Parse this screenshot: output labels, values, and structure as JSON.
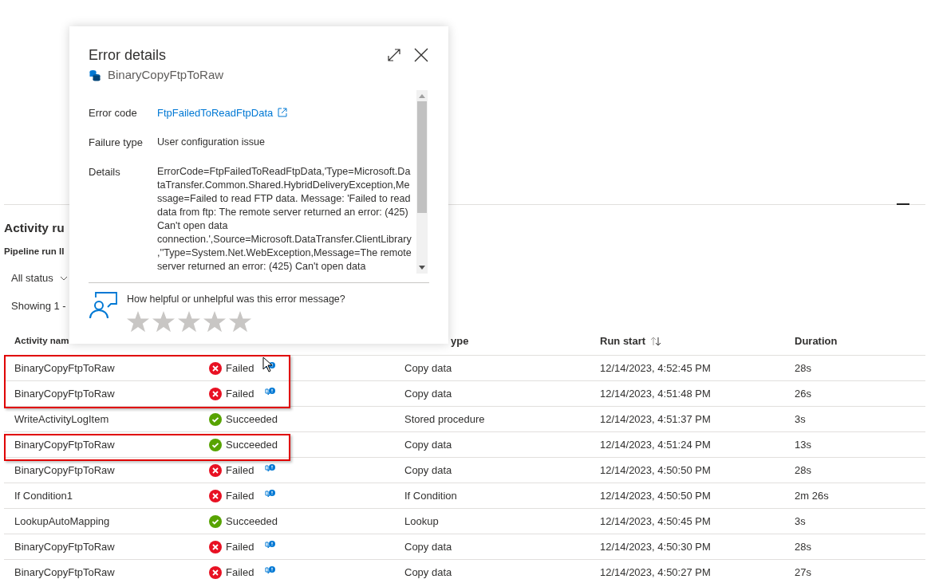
{
  "page": {
    "title": "Activity ru",
    "pipeline_run": "Pipeline run II",
    "status_filter": "All status",
    "showing": "Showing 1 -"
  },
  "table": {
    "columns": [
      {
        "label": "Activity nam"
      },
      {
        "label": "ype"
      },
      {
        "label": "Run start",
        "sortable": true
      },
      {
        "label": "Duration"
      }
    ],
    "rows": [
      {
        "name": "BinaryCopyFtpToRaw",
        "kind": "failed",
        "status_text": "Failed",
        "feedback": true,
        "type": "Copy data",
        "run_start": "12/14/2023, 4:52:45 PM",
        "duration": "28s",
        "highlighted": true
      },
      {
        "name": "BinaryCopyFtpToRaw",
        "kind": "failed",
        "status_text": "Failed",
        "feedback": true,
        "type": "Copy data",
        "run_start": "12/14/2023, 4:51:48 PM",
        "duration": "26s",
        "highlighted": true
      },
      {
        "name": "WriteActivityLogItem",
        "kind": "succeeded",
        "status_text": "Succeeded",
        "feedback": false,
        "type": "Stored procedure",
        "run_start": "12/14/2023, 4:51:37 PM",
        "duration": "3s",
        "highlighted": false
      },
      {
        "name": "BinaryCopyFtpToRaw",
        "kind": "succeeded",
        "status_text": "Succeeded",
        "feedback": false,
        "type": "Copy data",
        "run_start": "12/14/2023, 4:51:24 PM",
        "duration": "13s",
        "highlighted": true
      },
      {
        "name": "BinaryCopyFtpToRaw",
        "kind": "failed",
        "status_text": "Failed",
        "feedback": true,
        "type": "Copy data",
        "run_start": "12/14/2023, 4:50:50 PM",
        "duration": "28s",
        "highlighted": false
      },
      {
        "name": "If Condition1",
        "kind": "failed",
        "status_text": "Failed",
        "feedback": true,
        "type": "If Condition",
        "run_start": "12/14/2023, 4:50:50 PM",
        "duration": "2m 26s",
        "highlighted": false
      },
      {
        "name": "LookupAutoMapping",
        "kind": "succeeded",
        "status_text": "Succeeded",
        "feedback": false,
        "type": "Lookup",
        "run_start": "12/14/2023, 4:50:45 PM",
        "duration": "3s",
        "highlighted": false
      },
      {
        "name": "BinaryCopyFtpToRaw",
        "kind": "failed",
        "status_text": "Failed",
        "feedback": true,
        "type": "Copy data",
        "run_start": "12/14/2023, 4:50:30 PM",
        "duration": "28s",
        "highlighted": false
      },
      {
        "name": "BinaryCopyFtpToRaw",
        "kind": "failed",
        "status_text": "Failed",
        "feedback": true,
        "type": "Copy data",
        "run_start": "12/14/2023, 4:50:27 PM",
        "duration": "27s",
        "highlighted": false
      }
    ]
  },
  "popover": {
    "title": "Error details",
    "activity": "BinaryCopyFtpToRaw",
    "fields": [
      {
        "label": "Error code",
        "value": "FtpFailedToReadFtpData",
        "kind": "link"
      },
      {
        "label": "Failure type",
        "value": "User configuration issue",
        "kind": "text"
      },
      {
        "label": "Details",
        "value": "ErrorCode=FtpFailedToReadFtpData,'Type=Microsoft.DataTransfer.Common.Shared.HybridDeliveryException,Message=Failed to read FTP data. Message: 'Failed to read data from ftp: The remote server returned an error: (425) Can't open data connection.',Source=Microsoft.DataTransfer.ClientLibrary,''Type=System.Net.WebException,Message=The remote server returned an error: (425) Can't open data",
        "kind": "text"
      }
    ],
    "feedback": {
      "question": "How helpful or unhelpful was this error message?",
      "stars": 0
    }
  }
}
